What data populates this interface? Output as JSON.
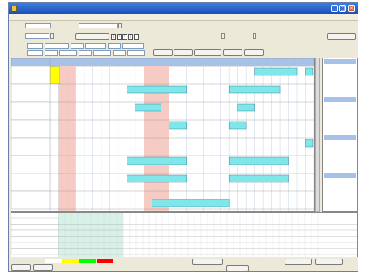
{
  "window": {
    "title": ""
  },
  "menu": [
    {
      "label": ""
    },
    {
      "label": ""
    },
    {
      "label": ""
    }
  ],
  "toolbar": {
    "row1": {
      "label1": "",
      "value1": "",
      "label2": "",
      "value2": "",
      "button": ""
    },
    "row2": {
      "label1": "",
      "value1": "",
      "button1": "",
      "label2": "",
      "label3": "",
      "button2": ""
    },
    "row3": {
      "f1": "",
      "f2": "",
      "f3": "",
      "f4": "",
      "f5": "",
      "f6": "",
      "f7": "",
      "label": ""
    },
    "row4": {
      "f1": "",
      "f2": "",
      "f3": "",
      "f4": "",
      "f5": "",
      "f6": "",
      "f7": "",
      "f8": "",
      "f9": "",
      "f10": "",
      "f11": "",
      "f12": "",
      "f13": ""
    },
    "notice": ""
  },
  "grid": {
    "corner": "",
    "subheader": "",
    "rows": [
      {
        "label": ""
      },
      {
        "label": ""
      },
      {
        "label": ""
      },
      {
        "label": ""
      },
      {
        "label": ""
      },
      {
        "label": ""
      },
      {
        "label": ""
      },
      {
        "label": ""
      }
    ],
    "bars": [
      {
        "label": ""
      },
      {
        "label": ""
      },
      {
        "label": ""
      },
      {
        "label": ""
      },
      {
        "label": ""
      },
      {
        "label": ""
      },
      {
        "label": ""
      },
      {
        "label": ""
      },
      {
        "label": ""
      },
      {
        "label": ""
      },
      {
        "label": ""
      },
      {
        "label": ""
      },
      {
        "label": ""
      },
      {
        "label": ""
      }
    ]
  },
  "calendars": [
    {
      "title": ""
    },
    {
      "title": ""
    },
    {
      "title": ""
    },
    {
      "title": ""
    }
  ],
  "load": {
    "rows": [
      {
        "label": "",
        "value": "",
        "level": null
      },
      {
        "label": "",
        "value": "",
        "level": null
      },
      {
        "label": "",
        "value": "",
        "level": null
      },
      {
        "label": "",
        "value": "",
        "level": null
      },
      {
        "label": "",
        "value": "",
        "level": null
      },
      {
        "label": "",
        "value": "",
        "level": null
      }
    ]
  },
  "footer": {
    "left_label": "",
    "legend": [
      {
        "label": "",
        "color": ""
      },
      {
        "label": "",
        "color": ""
      },
      {
        "label": "",
        "color": ""
      },
      {
        "label": "",
        "color": ""
      }
    ],
    "btn1": "",
    "btn2": "",
    "center_button": "",
    "ok_button": "",
    "cancel_button": "",
    "close_button": ""
  }
}
